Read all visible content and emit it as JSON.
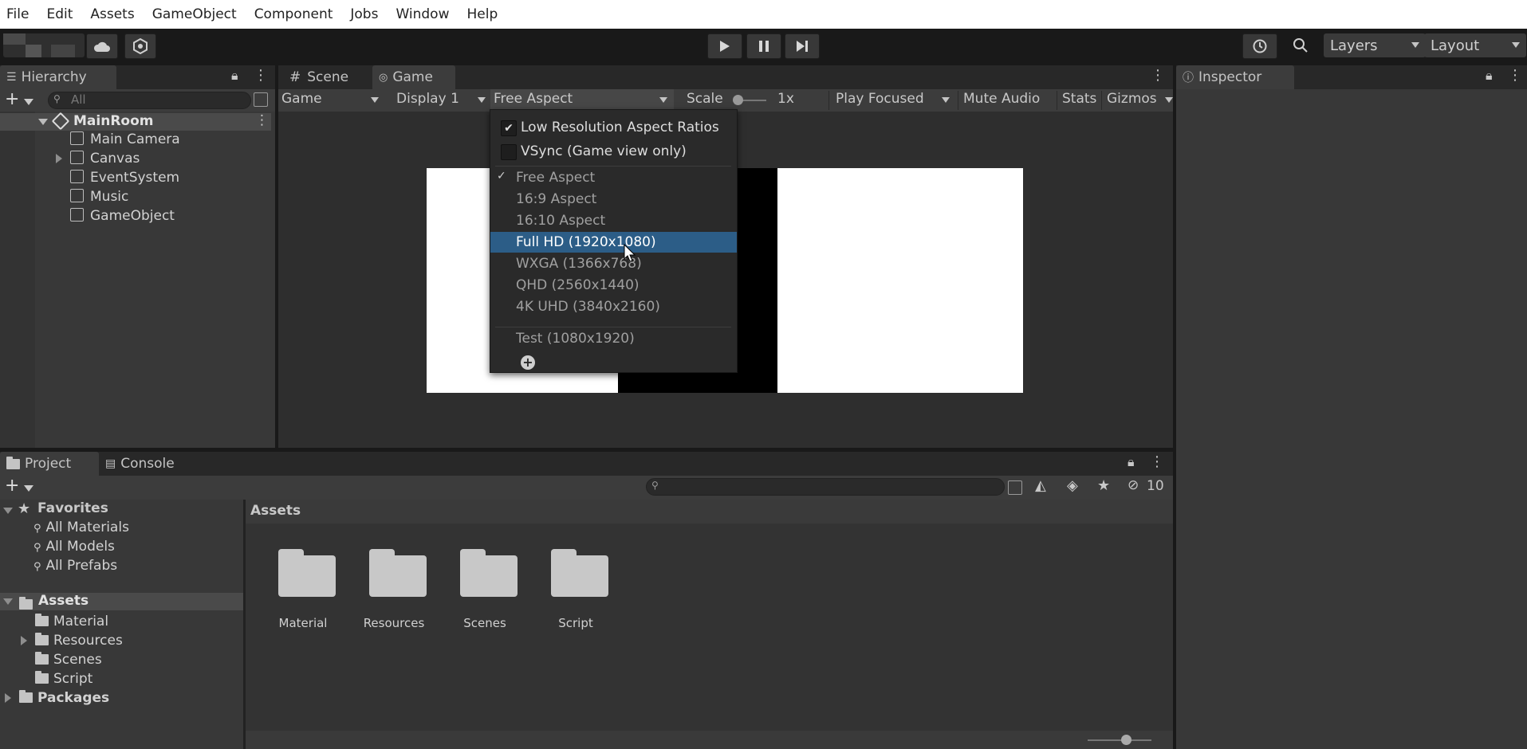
{
  "menu": [
    "File",
    "Edit",
    "Assets",
    "GameObject",
    "Component",
    "Jobs",
    "Window",
    "Help"
  ],
  "toolbar": {
    "layers": "Layers",
    "layout": "Layout"
  },
  "hierarchy": {
    "tab": "Hierarchy",
    "search_placeholder": "All",
    "scene": "MainRoom",
    "items": [
      "Main Camera",
      "Canvas",
      "EventSystem",
      "Music",
      "GameObject"
    ]
  },
  "view_tabs": {
    "scene": "Scene",
    "game": "Game"
  },
  "game_toolbar": {
    "mode": "Game",
    "display": "Display 1",
    "aspect": "Free Aspect",
    "scale_label": "Scale",
    "scale_value": "1x",
    "play_focused": "Play Focused",
    "mute_audio": "Mute Audio",
    "stats": "Stats",
    "gizmos": "Gizmos"
  },
  "aspect_menu": {
    "low_res": "Low Resolution Aspect Ratios",
    "vsync": "VSync (Game view only)",
    "options": [
      "Free Aspect",
      "16:9 Aspect",
      "16:10 Aspect",
      "Full HD (1920x1080)",
      "WXGA (1366x768)",
      "QHD (2560x1440)",
      "4K UHD (3840x2160)"
    ],
    "checked": "Free Aspect",
    "highlighted": "Full HD (1920x1080)",
    "custom": "Test (1080x1920)"
  },
  "inspector": {
    "tab": "Inspector"
  },
  "bottom_tabs": {
    "project": "Project",
    "console": "Console"
  },
  "project": {
    "hidden_count": "10",
    "favorites_label": "Favorites",
    "favorites": [
      "All Materials",
      "All Models",
      "All Prefabs"
    ],
    "assets_label": "Assets",
    "asset_folders": [
      "Material",
      "Resources",
      "Scenes",
      "Script"
    ],
    "packages_label": "Packages",
    "breadcrumb": "Assets",
    "grid_folders": [
      "Material",
      "Resources",
      "Scenes",
      "Script"
    ]
  },
  "colors": {
    "selection": "#2c5d87",
    "panel": "#383838",
    "background": "#191919"
  }
}
